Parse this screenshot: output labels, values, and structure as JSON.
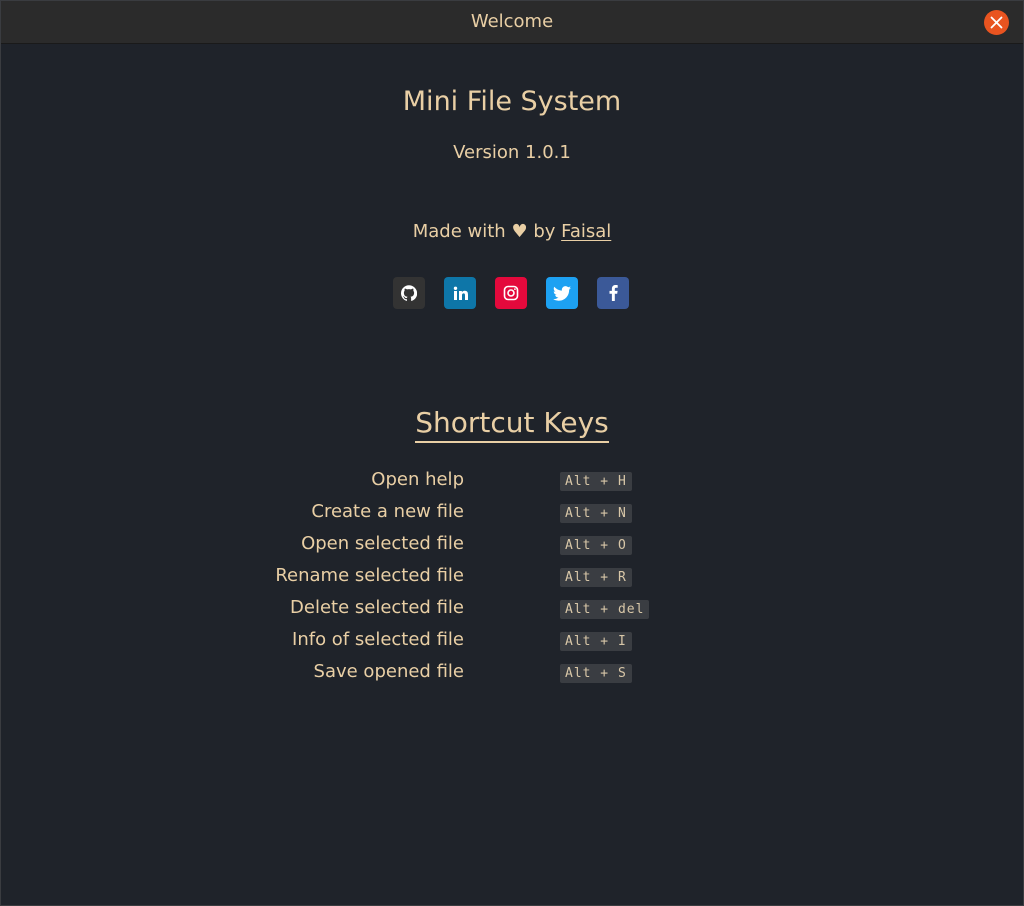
{
  "window": {
    "title": "Welcome"
  },
  "app": {
    "name": "Mini File System",
    "version": "Version 1.0.1",
    "made_with_prefix": "Made with",
    "heart": "♥",
    "made_with_by": "by",
    "author": "Faisal"
  },
  "socials": [
    {
      "name": "github",
      "icon": "github-icon",
      "color": "#333333"
    },
    {
      "name": "linkedin",
      "icon": "linkedin-icon",
      "color": "#0e76a8"
    },
    {
      "name": "instagram",
      "icon": "instagram-icon",
      "color": "#e4093c"
    },
    {
      "name": "twitter",
      "icon": "twitter-icon",
      "color": "#1da1f2"
    },
    {
      "name": "facebook",
      "icon": "facebook-icon",
      "color": "#3b5998"
    }
  ],
  "shortcuts": {
    "heading": "Shortcut Keys",
    "items": [
      {
        "label": "Open help",
        "keys": "Alt + H"
      },
      {
        "label": "Create a new file",
        "keys": "Alt + N"
      },
      {
        "label": "Open selected file",
        "keys": "Alt + O"
      },
      {
        "label": "Rename selected file",
        "keys": "Alt + R"
      },
      {
        "label": "Delete selected file",
        "keys": "Alt + del"
      },
      {
        "label": "Info of selected file",
        "keys": "Alt + I"
      },
      {
        "label": "Save opened file",
        "keys": "Alt + S"
      }
    ]
  },
  "colors": {
    "background": "#1f232a",
    "text": "#e9cfa5",
    "titlebar": "#2b2b2b",
    "close_button": "#e95420",
    "kbd_background": "#3a3d42"
  }
}
